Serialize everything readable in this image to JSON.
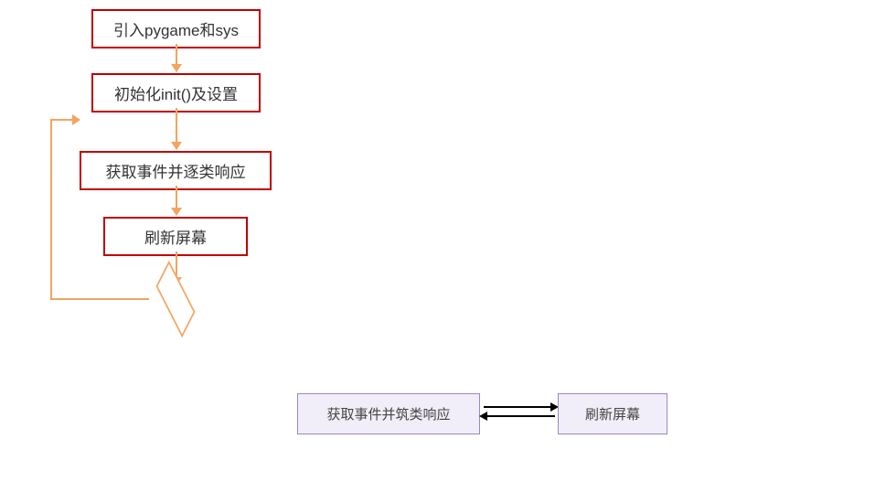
{
  "flowchart": {
    "step1": "引入pygame和sys",
    "step2": "初始化init()及设置",
    "step3": "获取事件并逐类响应",
    "step4": "刷新屏幕"
  },
  "bottom": {
    "left": "获取事件并筑类响应",
    "right": "刷新屏幕"
  }
}
